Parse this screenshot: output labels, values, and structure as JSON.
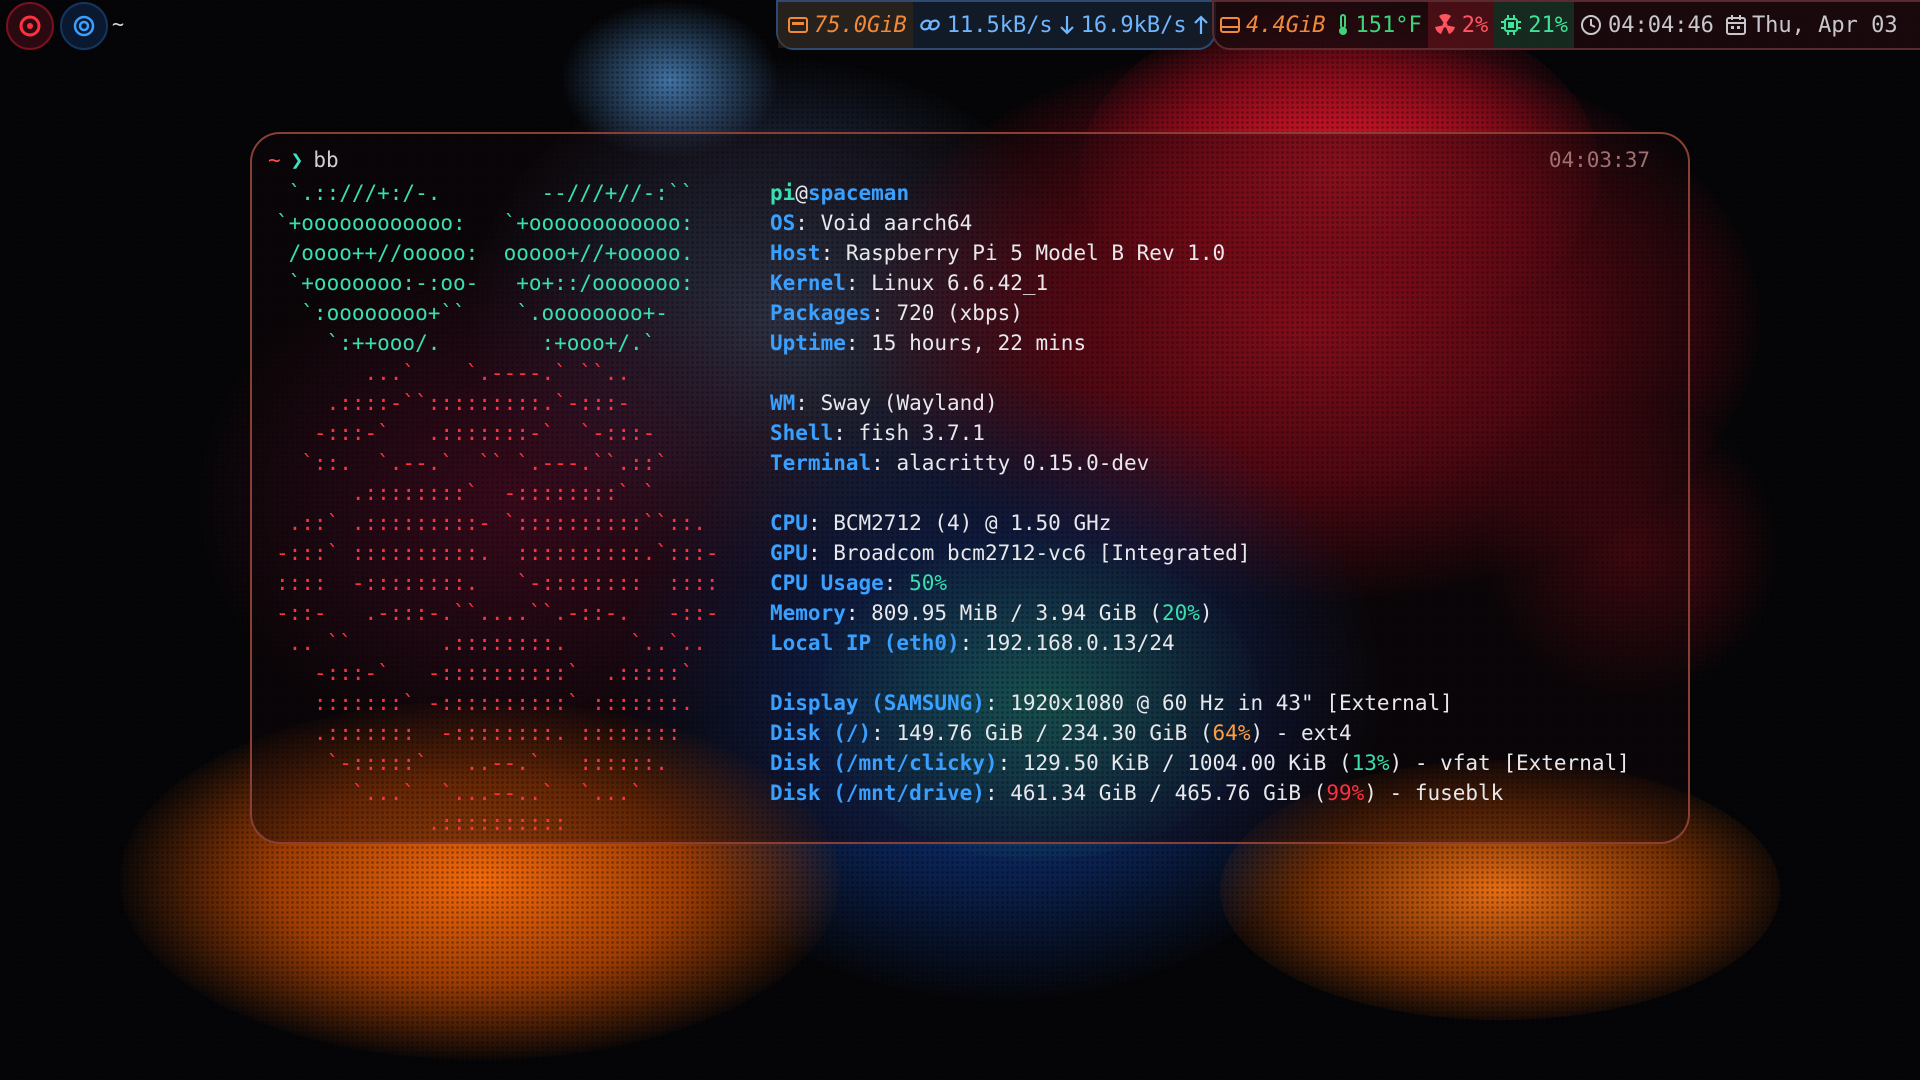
{
  "topbar": {
    "workspace_label": "~",
    "disk_free": "75.0GiB",
    "net_down": "11.5kB/s",
    "net_up": "16.9kB/s",
    "mem_used": "4.4GiB",
    "temperature": "151°F",
    "swap_pct": "2%",
    "cpu_pct": "21%",
    "clock": "04:04:46",
    "date": "Thu, Apr 03",
    "icons": [
      "debian-icon",
      "chrome-icon",
      "hdd-icon",
      "network-icon",
      "download-arrow-icon",
      "upload-arrow-icon",
      "memory-icon",
      "thermometer-icon",
      "radiation-icon",
      "cpu-chip-icon",
      "clock-icon",
      "calendar-icon"
    ]
  },
  "terminal": {
    "prompt_symbol": "~",
    "prompt_arrow": "❯",
    "command": "bb",
    "timestamp": "04:03:37",
    "ascii_teal": [
      " `.::///+:/-.        --///+//-:``",
      "`+oooooooooooo:   `+oooooooooooo:",
      " /oooo++//ooooo:  ooooo+//+ooooo.",
      " `+ooooooo:-:oo-   +o+::/ooooooo:",
      "  `:oooooooo+``    `.oooooooo+-",
      "    `:++ooo/.        :+ooo+/.`"
    ],
    "ascii_red": [
      "       ...`    `.----.` ``..",
      "    .::::-``:::::::::.`-:::-",
      "   -:::-`   .:::::::-`  `-:::-",
      "  `::.  `.--.`  `` `.---.``.::`",
      "      .::::::::`  -::::::::` `",
      " .::` .:::::::::- `::::::::::``::.",
      "-:::` ::::::::::.  ::::::::::.`:::-",
      "::::  -::::::::.   `-::::::::  ::::",
      "-::-   .-:::-.``....``.-::-.   -::-",
      " .. ``       .::::::::.     `..`..",
      "   -:::-`   -::::::::::`  .:::::`",
      "   :::::::` -::::::::::` :::::::.",
      "   .:::::::  -::::::::. ::::::::",
      "    `-:::::`   ..--.`   ::::::.",
      "      `...`  `...--..`  `...`",
      "            .::::::::::"
    ],
    "user": "pi",
    "at": "@",
    "hostname": "spaceman",
    "info": {
      "os_label": "OS",
      "os": "Void aarch64",
      "host_label": "Host",
      "host": "Raspberry Pi 5 Model B Rev 1.0",
      "kernel_label": "Kernel",
      "kernel": "Linux 6.6.42_1",
      "packages_label": "Packages",
      "packages": "720 (xbps)",
      "uptime_label": "Uptime",
      "uptime": "15 hours, 22 mins",
      "wm_label": "WM",
      "wm": "Sway (Wayland)",
      "shell_label": "Shell",
      "shell": "fish 3.7.1",
      "terminal_label": "Terminal",
      "terminal": "alacritty 0.15.0-dev",
      "cpu_label": "CPU",
      "cpu": "BCM2712 (4) @ 1.50 GHz",
      "gpu_label": "GPU",
      "gpu": "Broadcom bcm2712-vc6 [Integrated]",
      "cpu_usage_label": "CPU Usage",
      "cpu_usage": "50%",
      "memory_label": "Memory",
      "memory": "809.95 MiB / 3.94 GiB (",
      "memory_pct": "20%",
      "memory_close": ")",
      "localip_label": "Local IP (eth0)",
      "localip": "192.168.0.13/24",
      "display_label": "Display (SAMSUNG)",
      "display": "1920x1080 @ 60 Hz in 43\" [External]",
      "disk1_label": "Disk (/)",
      "disk1": "149.76 GiB / 234.30 GiB (",
      "disk1_pct": "64%",
      "disk1_tail": ") - ext4",
      "disk2_label": "Disk (/mnt/clicky)",
      "disk2": "129.50 KiB / 1004.00 KiB (",
      "disk2_pct": "13%",
      "disk2_tail": ") - vfat [External]",
      "disk3_label": "Disk (/mnt/drive)",
      "disk3": "461.34 GiB / 465.76 GiB (",
      "disk3_pct": "99%",
      "disk3_tail": ") - fuseblk"
    }
  },
  "colors": {
    "accent_teal": "#38e0b0",
    "accent_blue": "#3aa0ff",
    "accent_red": "#ff3040",
    "accent_orange": "#ffa040",
    "window_border": "#8a3f34"
  }
}
